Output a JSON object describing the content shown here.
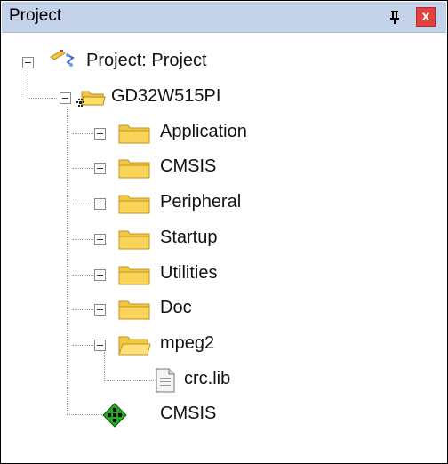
{
  "panel": {
    "title": "Project",
    "pin_icon": "pin-icon",
    "close_icon": "close-icon",
    "close_glyph": "x"
  },
  "tree": {
    "root": {
      "label": "Project: Project",
      "icon": "project-icon",
      "expanded": true
    },
    "target": {
      "label": "GD32W515PI",
      "icon": "target-folder-icon",
      "expanded": true
    },
    "groups": [
      {
        "label": "Application",
        "expanded": false
      },
      {
        "label": "CMSIS",
        "expanded": false
      },
      {
        "label": "Peripheral",
        "expanded": false
      },
      {
        "label": "Startup",
        "expanded": false
      },
      {
        "label": "Utilities",
        "expanded": false
      },
      {
        "label": "Doc",
        "expanded": false
      },
      {
        "label": "mpeg2",
        "expanded": true
      }
    ],
    "file": {
      "label": "crc.lib",
      "icon": "file-icon"
    },
    "component": {
      "label": "CMSIS",
      "icon": "component-icon"
    }
  },
  "colors": {
    "title_bar": "#c4d3ea",
    "close_button": "#e0433f",
    "folder": "#f2c744",
    "component": "#22aa22"
  }
}
